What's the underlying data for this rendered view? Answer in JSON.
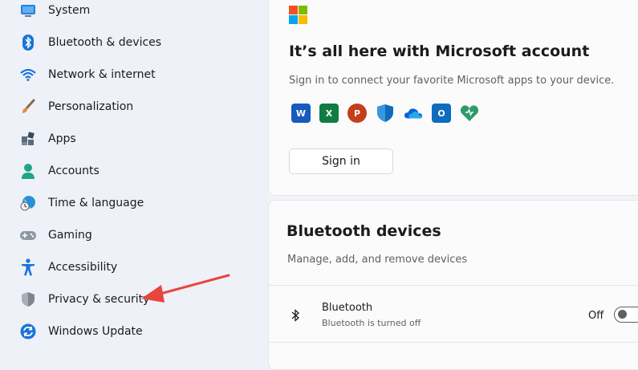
{
  "sidebar": {
    "items": [
      {
        "label": "System",
        "icon": "monitor-icon"
      },
      {
        "label": "Bluetooth & devices",
        "icon": "bluetooth-icon"
      },
      {
        "label": "Network & internet",
        "icon": "wifi-icon"
      },
      {
        "label": "Personalization",
        "icon": "paintbrush-icon"
      },
      {
        "label": "Apps",
        "icon": "apps-icon"
      },
      {
        "label": "Accounts",
        "icon": "person-icon"
      },
      {
        "label": "Time & language",
        "icon": "globe-clock-icon"
      },
      {
        "label": "Gaming",
        "icon": "gamepad-icon"
      },
      {
        "label": "Accessibility",
        "icon": "accessibility-icon"
      },
      {
        "label": "Privacy & security",
        "icon": "shield-icon"
      },
      {
        "label": "Windows Update",
        "icon": "update-sync-icon"
      }
    ]
  },
  "account_card": {
    "title": "It’s all here with Microsoft account",
    "subtitle": "Sign in to connect your favorite Microsoft apps to your device.",
    "apps": [
      {
        "name": "word-icon",
        "letter": "W",
        "color": "#185abd"
      },
      {
        "name": "excel-icon",
        "letter": "X",
        "color": "#107c41"
      },
      {
        "name": "powerpoint-icon",
        "letter": "P",
        "color": "#c43e1c"
      },
      {
        "name": "defender-icon",
        "letter": "",
        "color": "#0f6cbd"
      },
      {
        "name": "onedrive-icon",
        "letter": "",
        "color": "#0a64d0"
      },
      {
        "name": "outlook-icon",
        "letter": "O",
        "color": "#0f6cbd"
      },
      {
        "name": "family-icon",
        "letter": "",
        "color": "#2e9b6a"
      }
    ],
    "signin_label": "Sign in"
  },
  "bluetooth_card": {
    "title": "Bluetooth devices",
    "subtitle": "Manage, add, and remove devices",
    "bluetooth_label": "Bluetooth",
    "bluetooth_status": "Bluetooth is turned off",
    "toggle_state": "Off"
  },
  "colors": {
    "ms_red": "#f25022",
    "ms_green": "#7fba00",
    "ms_blue": "#00a4ef",
    "ms_yellow": "#ffb900",
    "accent": "#0067c0",
    "annotation_arrow": "#e8453c"
  }
}
